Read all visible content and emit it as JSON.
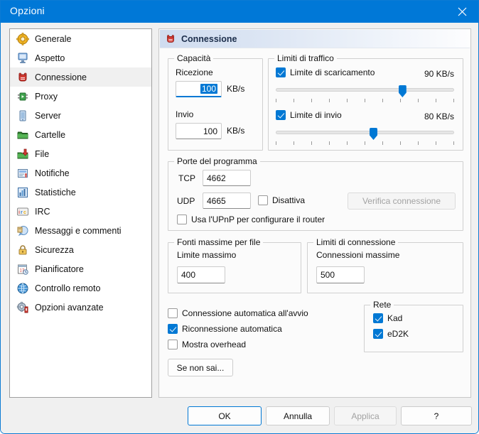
{
  "window": {
    "title": "Opzioni",
    "close_icon": "close-icon",
    "accent": "#0078d4",
    "titlebar_color": "#0078d7"
  },
  "sidebar": {
    "items": [
      {
        "label": "Generale",
        "icon": "gear-icon",
        "selected": false
      },
      {
        "label": "Aspetto",
        "icon": "monitor-icon",
        "selected": false
      },
      {
        "label": "Connessione",
        "icon": "emule-donkey-icon",
        "selected": true
      },
      {
        "label": "Proxy",
        "icon": "proxy-plug-icon",
        "selected": false
      },
      {
        "label": "Server",
        "icon": "server-icon",
        "selected": false
      },
      {
        "label": "Cartelle",
        "icon": "folder-icon",
        "selected": false
      },
      {
        "label": "File",
        "icon": "file-download-icon",
        "selected": false
      },
      {
        "label": "Notifiche",
        "icon": "notification-icon",
        "selected": false
      },
      {
        "label": "Statistiche",
        "icon": "statistics-icon",
        "selected": false
      },
      {
        "label": "IRC",
        "icon": "irc-icon",
        "selected": false
      },
      {
        "label": "Messaggi e commenti",
        "icon": "message-icon",
        "selected": false
      },
      {
        "label": "Sicurezza",
        "icon": "lock-icon",
        "selected": false
      },
      {
        "label": "Pianificatore",
        "icon": "calendar-clock-icon",
        "selected": false
      },
      {
        "label": "Controllo remoto",
        "icon": "globe-icon",
        "selected": false
      },
      {
        "label": "Opzioni avanzate",
        "icon": "advanced-gear-icon",
        "selected": false
      }
    ]
  },
  "panel": {
    "header_title": "Connessione",
    "header_icon": "emule-donkey-icon",
    "capacity": {
      "group_label": "Capacità",
      "download_label": "Ricezione",
      "download_value": "100",
      "download_unit": "KB/s",
      "upload_label": "Invio",
      "upload_value": "100",
      "upload_unit": "KB/s"
    },
    "traffic_limits": {
      "group_label": "Limiti di traffico",
      "download_limit_label": "Limite di scaricamento",
      "download_limit_checked": true,
      "download_limit_value": "90 KB/s",
      "download_slider_percent": 72,
      "upload_limit_label": "Limite di invio",
      "upload_limit_checked": true,
      "upload_limit_value": "80 KB/s",
      "upload_slider_percent": 55,
      "slider_tick_count": 11
    },
    "ports": {
      "group_label": "Porte del programma",
      "tcp_label": "TCP",
      "tcp_value": "4662",
      "udp_label": "UDP",
      "udp_value": "4665",
      "disable_label": "Disattiva",
      "disable_checked": false,
      "upnp_label": "Usa l'UPnP per configurare il router",
      "upnp_checked": false,
      "test_button_label": "Verifica connessione",
      "test_button_disabled": true
    },
    "max_sources": {
      "group_label": "Fonti massime per file",
      "limit_label": "Limite massimo",
      "limit_value": "400"
    },
    "connection_limits": {
      "group_label": "Limiti di connessione",
      "max_label": "Connessioni massime",
      "max_value": "500"
    },
    "options": [
      {
        "label": "Connessione automatica all'avvio",
        "checked": false
      },
      {
        "label": "Riconnessione automatica",
        "checked": true
      },
      {
        "label": "Mostra overhead",
        "checked": false
      }
    ],
    "wizard_button_label": "Se non sai...",
    "network": {
      "group_label": "Rete",
      "items": [
        {
          "label": "Kad",
          "checked": true
        },
        {
          "label": "eD2K",
          "checked": true
        }
      ]
    }
  },
  "footer": {
    "ok_label": "OK",
    "cancel_label": "Annulla",
    "apply_label": "Applica",
    "apply_disabled": true,
    "help_label": "?"
  }
}
